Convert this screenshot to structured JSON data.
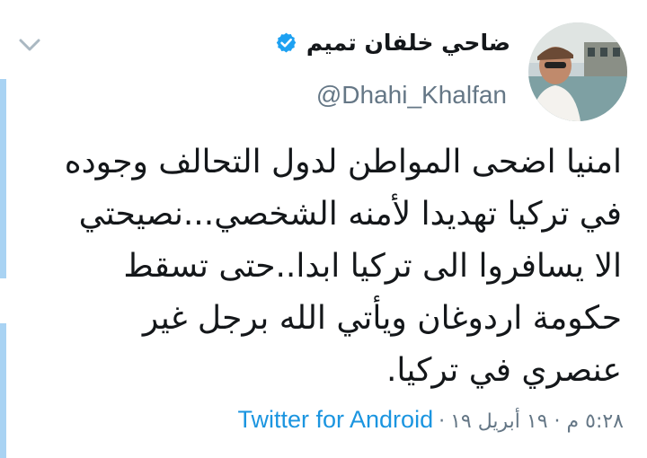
{
  "author": {
    "display_name": "ضاحي خلفان تميم",
    "handle": "@Dhahi_Khalfan",
    "verified": true
  },
  "tweet": {
    "lines": [
      "امنيا اضحى المواطن لدول التحالف وجوده",
      "في تركيا تهديدا لأمنه الشخصي...نصيحتي",
      "الا يسافروا الى تركيا ابدا..حتى تسقط",
      "حكومة اردوغان ويأتي الله برجل غير",
      "عنصري في تركيا."
    ]
  },
  "meta": {
    "timestamp": "٥:٢٨ م · ١٩ أبريل ١٩",
    "separator": "·",
    "source": "Twitter for Android"
  },
  "icons": {
    "menu": "chevron-down-icon",
    "verified": "verified-badge-icon"
  },
  "colors": {
    "link": "#1b95e0",
    "muted": "#657786",
    "text": "#14171a",
    "thread_bar": "#a9d3f3"
  }
}
